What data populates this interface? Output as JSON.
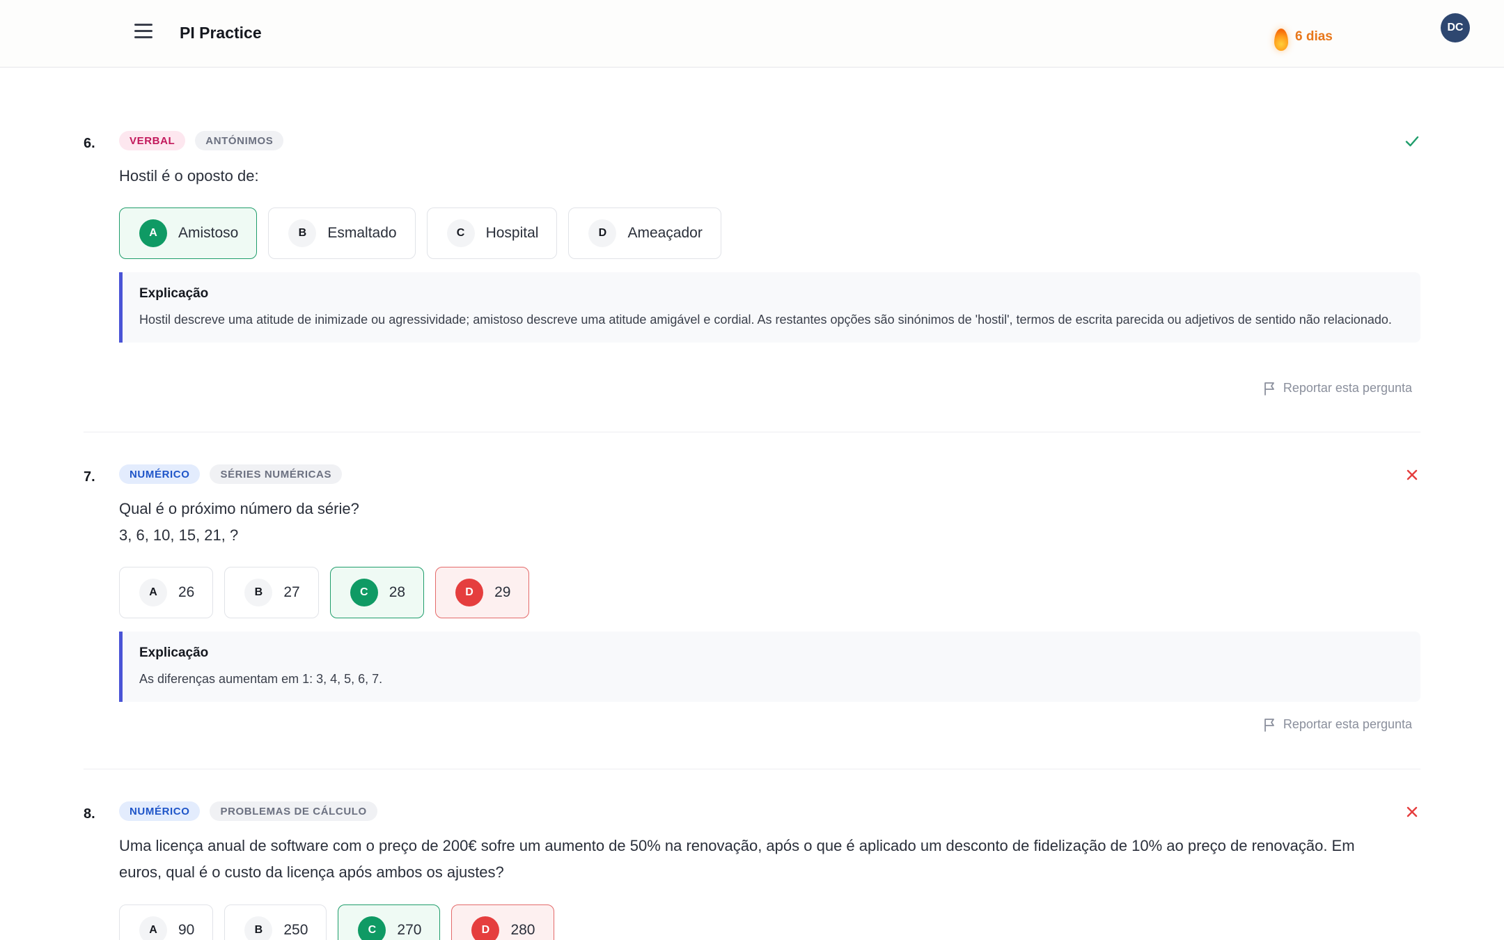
{
  "header": {
    "app_title": "PI Practice",
    "menu_icon": "hamburger-menu-icon",
    "streak_icon": "flame-icon",
    "streak_label": "6 dias",
    "avatar_initials": "DC"
  },
  "colors": {
    "accent": "#4a54d6",
    "correct": "#0f9a64",
    "wrong": "#e53e3e",
    "streak": "#e8771a",
    "avatar": "#2e4770"
  },
  "report_label": "Reportar esta pergunta",
  "explanation_title": "Explicação",
  "questions": [
    {
      "number": "6.",
      "category": "VERBAL",
      "topic": "ANTÓNIMOS",
      "status": "correct",
      "status_icon": "check-icon",
      "text_lines": [
        "Hostil é o oposto de:"
      ],
      "options": [
        {
          "letter": "A",
          "text": "Amistoso",
          "state": "correct"
        },
        {
          "letter": "B",
          "text": "Esmaltado",
          "state": "neutral"
        },
        {
          "letter": "C",
          "text": "Hospital",
          "state": "neutral"
        },
        {
          "letter": "D",
          "text": "Ameaçador",
          "state": "neutral"
        }
      ],
      "explanation": "Hostil descreve uma atitude de inimizade ou agressividade; amistoso descreve uma atitude amigável e cordial. As restantes opções são sinónimos de 'hostil', termos de escrita parecida ou adjetivos de sentido não relacionado."
    },
    {
      "number": "7.",
      "category": "NUMÉRICO",
      "topic": "SÉRIES NUMÉRICAS",
      "status": "wrong",
      "status_icon": "close-icon",
      "text_lines": [
        "Qual é o próximo número da série?",
        "3, 6, 10, 15, 21, ?"
      ],
      "options": [
        {
          "letter": "A",
          "text": "26",
          "state": "neutral"
        },
        {
          "letter": "B",
          "text": "27",
          "state": "neutral"
        },
        {
          "letter": "C",
          "text": "28",
          "state": "correct"
        },
        {
          "letter": "D",
          "text": "29",
          "state": "wrong"
        }
      ],
      "explanation": "As diferenças aumentam em 1: 3, 4, 5, 6, 7."
    },
    {
      "number": "8.",
      "category": "NUMÉRICO",
      "topic": "PROBLEMAS DE CÁLCULO",
      "status": "wrong",
      "status_icon": "close-icon",
      "text_lines": [
        "Uma licença anual de software com o preço de 200€ sofre um aumento de 50% na renovação, após o que é aplicado um desconto de fidelização de 10% ao preço de renovação. Em",
        "euros, qual é o custo da licença após ambos os ajustes?"
      ],
      "options": [
        {
          "letter": "A",
          "text": "90",
          "state": "neutral"
        },
        {
          "letter": "B",
          "text": "250",
          "state": "neutral"
        },
        {
          "letter": "C",
          "text": "270",
          "state": "correct"
        },
        {
          "letter": "D",
          "text": "280",
          "state": "wrong"
        }
      ]
    }
  ]
}
